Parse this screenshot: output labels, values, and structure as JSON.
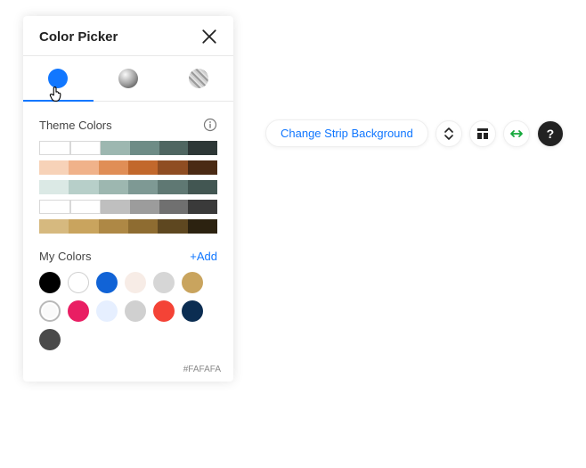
{
  "panel": {
    "title": "Color Picker",
    "tabs": [
      "solid",
      "gradient",
      "image"
    ],
    "active_tab": 0,
    "theme_section_label": "Theme Colors",
    "theme_rows": [
      [
        "#ffffff",
        "#ffffff",
        "#9db7b0",
        "#6e8c86",
        "#4f6661",
        "#2d3736"
      ],
      [
        "#f7d2b8",
        "#f0b28a",
        "#e08e56",
        "#c2682c",
        "#8f4d22",
        "#4a2a14"
      ],
      [
        "#dbe9e5",
        "#b7cfc9",
        "#9db7b0",
        "#7e9994",
        "#5f7873",
        "#425652"
      ],
      [
        "#ffffff",
        "#ffffff",
        "#bfbfbf",
        "#9c9c9c",
        "#707070",
        "#3a3a3a"
      ],
      [
        "#d6b97f",
        "#c9a45e",
        "#ae8845",
        "#8e6c31",
        "#5e4720",
        "#2c2210"
      ]
    ],
    "my_colors_label": "My Colors",
    "my_colors_add": "+Add",
    "my_colors": [
      "#000000",
      "#ffffff",
      "#1163d6",
      "#f7ece6",
      "#d6d6d6",
      "#c9a45e",
      "#fafafa",
      "#e91e63",
      "#e6efff",
      "#d0d0d0",
      "#f44336",
      "#0b2d52",
      "#4a4a4a"
    ],
    "selected_my_color_index": 6,
    "hex_label": "#FAFAFA"
  },
  "toolbar": {
    "change_bg_label": "Change Strip Background",
    "help_label": "?"
  }
}
